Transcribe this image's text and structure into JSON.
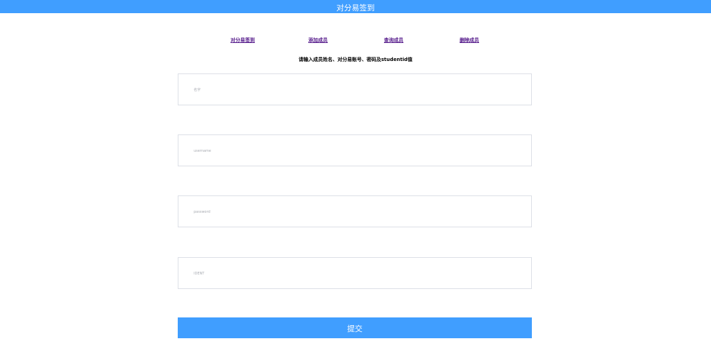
{
  "header": {
    "title": "对分易签到"
  },
  "nav": {
    "items": [
      {
        "label": "对分易签到"
      },
      {
        "label": "添加成员"
      },
      {
        "label": "查询成员"
      },
      {
        "label": "删除成员"
      }
    ]
  },
  "form": {
    "hint": "请输入成员姓名、对分易账号、密码及studentid值",
    "fields": [
      {
        "placeholder": "名字",
        "value": ""
      },
      {
        "placeholder": "username",
        "value": ""
      },
      {
        "placeholder": "password",
        "value": ""
      },
      {
        "placeholder": "IDENT",
        "value": ""
      }
    ],
    "submit_label": "提交"
  },
  "colors": {
    "primary": "#409eff",
    "border": "#dcdfe6",
    "link": "#551a8b"
  }
}
